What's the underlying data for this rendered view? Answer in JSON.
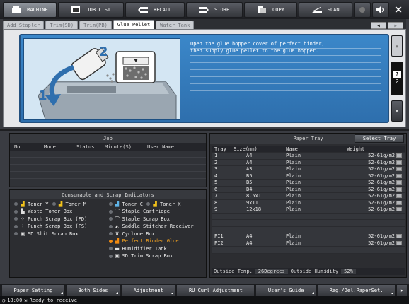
{
  "topbar": {
    "machine": "MACHINE",
    "job_list": "JOB LIST",
    "recall": "RECALL",
    "store": "STORE",
    "copy": "COPY",
    "scan": "SCAN"
  },
  "tabs": [
    {
      "label": "Add Stapler",
      "active": false
    },
    {
      "label": "Trim(SD)",
      "active": false
    },
    {
      "label": "Trim(PB)",
      "active": false
    },
    {
      "label": "Glue Pellet",
      "active": true
    },
    {
      "label": "Water Tank",
      "active": false
    }
  ],
  "guide": {
    "line1": "Open the glue hopper cover of perfect binder,",
    "line2": "then supply glue pellet to the glue hopper.",
    "step1": "1",
    "step2": "2",
    "page_current": "1",
    "page_total": "2"
  },
  "job": {
    "title": "Job",
    "columns": [
      "No.",
      "Mode",
      "Status",
      "Minute(S)",
      "User Name"
    ],
    "row_count": 5
  },
  "consumables": {
    "title": "Consumable and Scrap Indicators",
    "left": [
      {
        "type": "toner-pair",
        "a": "Toner Y",
        "b": "Toner M"
      },
      {
        "type": "item",
        "icon": "waste-toner-box-icon",
        "label": "Waste Toner Box"
      },
      {
        "type": "item",
        "icon": "punch-scrap-box-icon",
        "label": "Punch Scrap Box (FD)"
      },
      {
        "type": "item",
        "icon": "punch-scrap-box-icon",
        "label": "Punch Scrap Box (FS)"
      },
      {
        "type": "item",
        "icon": "slit-scrap-box-icon",
        "label": "SD Slit Scrap Box"
      }
    ],
    "right": [
      {
        "type": "toner-pair",
        "a": "Toner C",
        "b": "Toner K"
      },
      {
        "type": "item",
        "icon": "staple-cartridge-icon",
        "label": "Staple Cartridge",
        "warn": false
      },
      {
        "type": "item",
        "icon": "staple-scrap-box-icon",
        "label": "Staple Scrap Box",
        "warn": false
      },
      {
        "type": "item",
        "icon": "saddle-stitcher-receiver-icon",
        "label": "Saddle Stitcher Receiver",
        "warn": false
      },
      {
        "type": "item",
        "icon": "cyclone-box-icon",
        "label": "Cyclone Box",
        "warn": false
      },
      {
        "type": "item",
        "icon": "glue-pellet-icon",
        "label": "Perfect Binder Glue",
        "warn": true
      },
      {
        "type": "item",
        "icon": "humidifier-tank-icon",
        "label": "Humidifier Tank",
        "warn": false
      },
      {
        "type": "item",
        "icon": "trim-scrap-box-icon",
        "label": "SD Trim Scrap Box",
        "warn": false
      }
    ]
  },
  "tray": {
    "title": "Paper Tray",
    "select_label": "Select Tray",
    "columns": {
      "tray": "Tray",
      "size": "Size(mm)",
      "name": "Name",
      "weight": "Weight"
    },
    "rows": [
      {
        "tray": "1",
        "size": "A4",
        "name": "Plain",
        "weight": "52-61g/m2"
      },
      {
        "tray": "2",
        "size": "A4",
        "name": "Plain",
        "weight": "52-61g/m2"
      },
      {
        "tray": "3",
        "size": "A3",
        "name": "Plain",
        "weight": "52-61g/m2"
      },
      {
        "tray": "4",
        "size": "B5",
        "name": "Plain",
        "weight": "52-61g/m2"
      },
      {
        "tray": "5",
        "size": "B5",
        "name": "Plain",
        "weight": "52-61g/m2"
      },
      {
        "tray": "6",
        "size": "B4",
        "name": "Plain",
        "weight": "52-61g/m2"
      },
      {
        "tray": "7",
        "size": "8.5x11",
        "name": "Plain",
        "weight": "52-61g/m2"
      },
      {
        "tray": "8",
        "size": "9x11",
        "name": "Plain",
        "weight": "52-61g/m2"
      },
      {
        "tray": "9",
        "size": "12x18",
        "name": "Plain",
        "weight": "52-61g/m2"
      }
    ],
    "pi_rows": [
      {
        "tray": "PI1",
        "size": "A4",
        "name": "Plain",
        "weight": "52-61g/m2"
      },
      {
        "tray": "PI2",
        "size": "A4",
        "name": "Plain",
        "weight": "52-61g/m2"
      }
    ],
    "outside_temp_label": "Outside Temp.",
    "outside_temp_value": "26Degrees",
    "outside_humidity_label": "Outside Humidity",
    "outside_humidity_value": "52%"
  },
  "bottombar": {
    "paper_setting": "Paper Setting",
    "both_sides": "Both Sides",
    "adjustment": "Adjustment",
    "ru_curl": "RU Curl Adjustment",
    "users_guide": "User's Guide",
    "reg_del_paperset": "Reg./Del.PaperSet."
  },
  "status": {
    "time": "18:00",
    "message": "Ready to receive"
  },
  "colors": {
    "guide_blue": "#3b87c9",
    "warning_orange": "#f08a10",
    "toner_yellow": "#f2c21a"
  }
}
